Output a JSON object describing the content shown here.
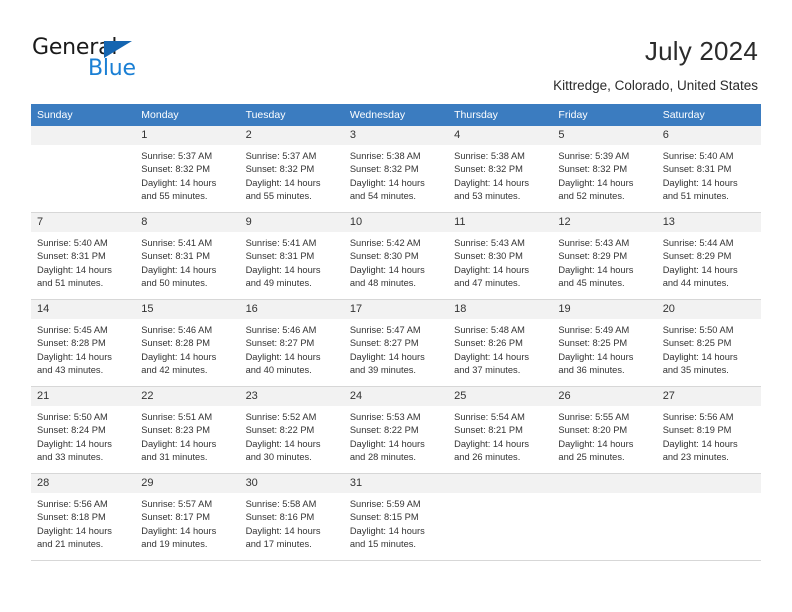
{
  "brand": {
    "name_dark": "General",
    "name_light": "Blue",
    "accent_color": "#1a7fd4",
    "header_blue": "#3b7cc0"
  },
  "header": {
    "title": "July 2024",
    "subtitle": "Kittredge, Colorado, United States"
  },
  "calendar": {
    "weekday_headers": [
      "Sunday",
      "Monday",
      "Tuesday",
      "Wednesday",
      "Thursday",
      "Friday",
      "Saturday"
    ],
    "weeks": [
      [
        {
          "day": "",
          "sunrise": "",
          "sunset": "",
          "daylight_line1": "",
          "daylight_line2": ""
        },
        {
          "day": "1",
          "sunrise": "Sunrise: 5:37 AM",
          "sunset": "Sunset: 8:32 PM",
          "daylight_line1": "Daylight: 14 hours",
          "daylight_line2": "and 55 minutes."
        },
        {
          "day": "2",
          "sunrise": "Sunrise: 5:37 AM",
          "sunset": "Sunset: 8:32 PM",
          "daylight_line1": "Daylight: 14 hours",
          "daylight_line2": "and 55 minutes."
        },
        {
          "day": "3",
          "sunrise": "Sunrise: 5:38 AM",
          "sunset": "Sunset: 8:32 PM",
          "daylight_line1": "Daylight: 14 hours",
          "daylight_line2": "and 54 minutes."
        },
        {
          "day": "4",
          "sunrise": "Sunrise: 5:38 AM",
          "sunset": "Sunset: 8:32 PM",
          "daylight_line1": "Daylight: 14 hours",
          "daylight_line2": "and 53 minutes."
        },
        {
          "day": "5",
          "sunrise": "Sunrise: 5:39 AM",
          "sunset": "Sunset: 8:32 PM",
          "daylight_line1": "Daylight: 14 hours",
          "daylight_line2": "and 52 minutes."
        },
        {
          "day": "6",
          "sunrise": "Sunrise: 5:40 AM",
          "sunset": "Sunset: 8:31 PM",
          "daylight_line1": "Daylight: 14 hours",
          "daylight_line2": "and 51 minutes."
        }
      ],
      [
        {
          "day": "7",
          "sunrise": "Sunrise: 5:40 AM",
          "sunset": "Sunset: 8:31 PM",
          "daylight_line1": "Daylight: 14 hours",
          "daylight_line2": "and 51 minutes."
        },
        {
          "day": "8",
          "sunrise": "Sunrise: 5:41 AM",
          "sunset": "Sunset: 8:31 PM",
          "daylight_line1": "Daylight: 14 hours",
          "daylight_line2": "and 50 minutes."
        },
        {
          "day": "9",
          "sunrise": "Sunrise: 5:41 AM",
          "sunset": "Sunset: 8:31 PM",
          "daylight_line1": "Daylight: 14 hours",
          "daylight_line2": "and 49 minutes."
        },
        {
          "day": "10",
          "sunrise": "Sunrise: 5:42 AM",
          "sunset": "Sunset: 8:30 PM",
          "daylight_line1": "Daylight: 14 hours",
          "daylight_line2": "and 48 minutes."
        },
        {
          "day": "11",
          "sunrise": "Sunrise: 5:43 AM",
          "sunset": "Sunset: 8:30 PM",
          "daylight_line1": "Daylight: 14 hours",
          "daylight_line2": "and 47 minutes."
        },
        {
          "day": "12",
          "sunrise": "Sunrise: 5:43 AM",
          "sunset": "Sunset: 8:29 PM",
          "daylight_line1": "Daylight: 14 hours",
          "daylight_line2": "and 45 minutes."
        },
        {
          "day": "13",
          "sunrise": "Sunrise: 5:44 AM",
          "sunset": "Sunset: 8:29 PM",
          "daylight_line1": "Daylight: 14 hours",
          "daylight_line2": "and 44 minutes."
        }
      ],
      [
        {
          "day": "14",
          "sunrise": "Sunrise: 5:45 AM",
          "sunset": "Sunset: 8:28 PM",
          "daylight_line1": "Daylight: 14 hours",
          "daylight_line2": "and 43 minutes."
        },
        {
          "day": "15",
          "sunrise": "Sunrise: 5:46 AM",
          "sunset": "Sunset: 8:28 PM",
          "daylight_line1": "Daylight: 14 hours",
          "daylight_line2": "and 42 minutes."
        },
        {
          "day": "16",
          "sunrise": "Sunrise: 5:46 AM",
          "sunset": "Sunset: 8:27 PM",
          "daylight_line1": "Daylight: 14 hours",
          "daylight_line2": "and 40 minutes."
        },
        {
          "day": "17",
          "sunrise": "Sunrise: 5:47 AM",
          "sunset": "Sunset: 8:27 PM",
          "daylight_line1": "Daylight: 14 hours",
          "daylight_line2": "and 39 minutes."
        },
        {
          "day": "18",
          "sunrise": "Sunrise: 5:48 AM",
          "sunset": "Sunset: 8:26 PM",
          "daylight_line1": "Daylight: 14 hours",
          "daylight_line2": "and 37 minutes."
        },
        {
          "day": "19",
          "sunrise": "Sunrise: 5:49 AM",
          "sunset": "Sunset: 8:25 PM",
          "daylight_line1": "Daylight: 14 hours",
          "daylight_line2": "and 36 minutes."
        },
        {
          "day": "20",
          "sunrise": "Sunrise: 5:50 AM",
          "sunset": "Sunset: 8:25 PM",
          "daylight_line1": "Daylight: 14 hours",
          "daylight_line2": "and 35 minutes."
        }
      ],
      [
        {
          "day": "21",
          "sunrise": "Sunrise: 5:50 AM",
          "sunset": "Sunset: 8:24 PM",
          "daylight_line1": "Daylight: 14 hours",
          "daylight_line2": "and 33 minutes."
        },
        {
          "day": "22",
          "sunrise": "Sunrise: 5:51 AM",
          "sunset": "Sunset: 8:23 PM",
          "daylight_line1": "Daylight: 14 hours",
          "daylight_line2": "and 31 minutes."
        },
        {
          "day": "23",
          "sunrise": "Sunrise: 5:52 AM",
          "sunset": "Sunset: 8:22 PM",
          "daylight_line1": "Daylight: 14 hours",
          "daylight_line2": "and 30 minutes."
        },
        {
          "day": "24",
          "sunrise": "Sunrise: 5:53 AM",
          "sunset": "Sunset: 8:22 PM",
          "daylight_line1": "Daylight: 14 hours",
          "daylight_line2": "and 28 minutes."
        },
        {
          "day": "25",
          "sunrise": "Sunrise: 5:54 AM",
          "sunset": "Sunset: 8:21 PM",
          "daylight_line1": "Daylight: 14 hours",
          "daylight_line2": "and 26 minutes."
        },
        {
          "day": "26",
          "sunrise": "Sunrise: 5:55 AM",
          "sunset": "Sunset: 8:20 PM",
          "daylight_line1": "Daylight: 14 hours",
          "daylight_line2": "and 25 minutes."
        },
        {
          "day": "27",
          "sunrise": "Sunrise: 5:56 AM",
          "sunset": "Sunset: 8:19 PM",
          "daylight_line1": "Daylight: 14 hours",
          "daylight_line2": "and 23 minutes."
        }
      ],
      [
        {
          "day": "28",
          "sunrise": "Sunrise: 5:56 AM",
          "sunset": "Sunset: 8:18 PM",
          "daylight_line1": "Daylight: 14 hours",
          "daylight_line2": "and 21 minutes."
        },
        {
          "day": "29",
          "sunrise": "Sunrise: 5:57 AM",
          "sunset": "Sunset: 8:17 PM",
          "daylight_line1": "Daylight: 14 hours",
          "daylight_line2": "and 19 minutes."
        },
        {
          "day": "30",
          "sunrise": "Sunrise: 5:58 AM",
          "sunset": "Sunset: 8:16 PM",
          "daylight_line1": "Daylight: 14 hours",
          "daylight_line2": "and 17 minutes."
        },
        {
          "day": "31",
          "sunrise": "Sunrise: 5:59 AM",
          "sunset": "Sunset: 8:15 PM",
          "daylight_line1": "Daylight: 14 hours",
          "daylight_line2": "and 15 minutes."
        },
        {
          "day": "",
          "sunrise": "",
          "sunset": "",
          "daylight_line1": "",
          "daylight_line2": ""
        },
        {
          "day": "",
          "sunrise": "",
          "sunset": "",
          "daylight_line1": "",
          "daylight_line2": ""
        },
        {
          "day": "",
          "sunrise": "",
          "sunset": "",
          "daylight_line1": "",
          "daylight_line2": ""
        }
      ]
    ]
  }
}
